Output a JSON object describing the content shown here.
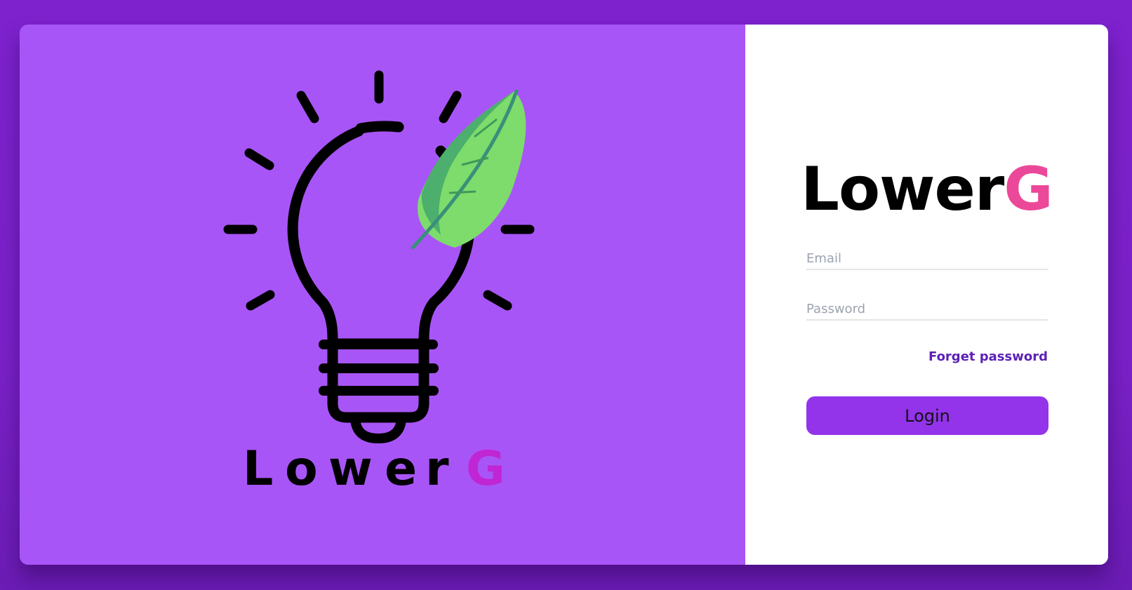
{
  "brand": {
    "logo_letters": [
      "L",
      "o",
      "w",
      "e",
      "r"
    ],
    "logo_accent_letter": "G",
    "title_main": "Lower",
    "title_accent": "G"
  },
  "colors": {
    "page_background": "#7e22ce",
    "left_panel": "#a855f7",
    "accent_pink": "#ec4899",
    "leaf_green": "#4caf6d",
    "button": "#9333ea",
    "forgot_link": "#5b21b6"
  },
  "icons": {
    "logo": "lightbulb-icon",
    "leaf": "leaf-icon"
  },
  "form": {
    "email_placeholder": "Email",
    "email_value": "",
    "password_placeholder": "Password",
    "password_value": "",
    "forgot_label": "Forget password",
    "login_label": "Login"
  }
}
